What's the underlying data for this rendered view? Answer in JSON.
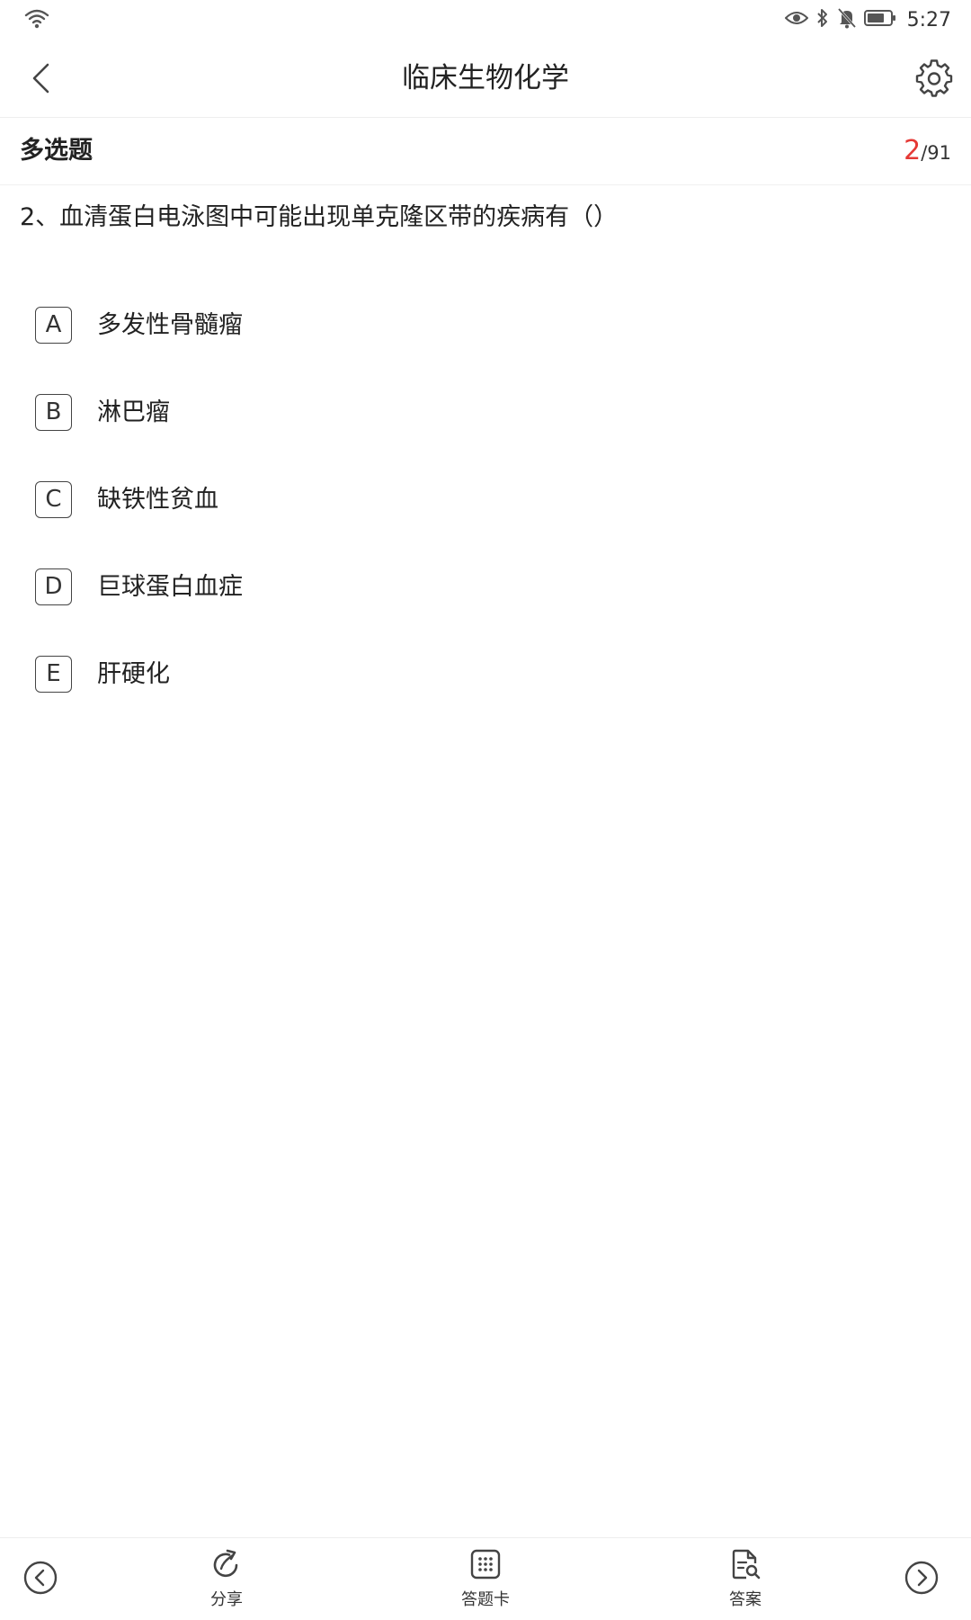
{
  "status_bar": {
    "time": "5:27",
    "icons": [
      "wifi-icon",
      "eye-icon",
      "bluetooth-icon",
      "bell-off-icon",
      "battery-icon"
    ]
  },
  "header": {
    "title": "临床生物化学",
    "back_icon": "chevron-left-icon",
    "settings_icon": "gear-icon"
  },
  "question_meta": {
    "type_label": "多选题",
    "current": "2",
    "separator": "/",
    "total": "91"
  },
  "question": {
    "text": "2、血清蛋白电泳图中可能出现单克隆区带的疾病有（）"
  },
  "options": [
    {
      "letter": "A",
      "text": "多发性骨髓瘤"
    },
    {
      "letter": "B",
      "text": "淋巴瘤"
    },
    {
      "letter": "C",
      "text": "缺铁性贫血"
    },
    {
      "letter": "D",
      "text": "巨球蛋白血症"
    },
    {
      "letter": "E",
      "text": "肝硬化"
    }
  ],
  "bottom_bar": {
    "share_label": "分享",
    "answer_card_label": "答题卡",
    "answer_label": "答案"
  },
  "colors": {
    "accent": "#e53935",
    "text": "#222222",
    "divider": "#eeeeee"
  }
}
